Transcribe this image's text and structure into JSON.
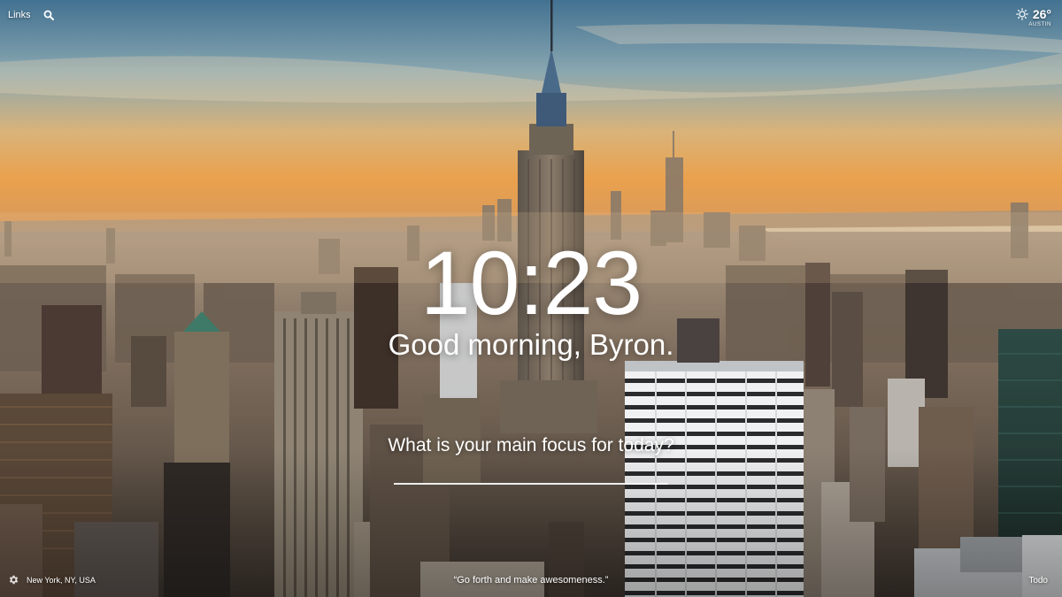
{
  "top_bar": {
    "links_label": "Links",
    "search_icon": "search-icon"
  },
  "weather": {
    "icon": "sun-icon",
    "temperature": "26°",
    "location": "AUSTIN"
  },
  "center": {
    "time": "10:23",
    "greeting": "Good morning, Byron.",
    "focus_question": "What is your main focus for today?",
    "focus_value": ""
  },
  "bottom_bar": {
    "settings_icon": "gear-icon",
    "photo_location": "New York, NY, USA",
    "quote": "“Go forth and make awesomeness.”",
    "todo_label": "Todo"
  },
  "colors": {
    "text": "#ffffff",
    "sky_top": "#5f8fb0",
    "sky_glow": "#e8a24a",
    "haze": "#c9a27a",
    "city_dark": "#3a3631"
  }
}
